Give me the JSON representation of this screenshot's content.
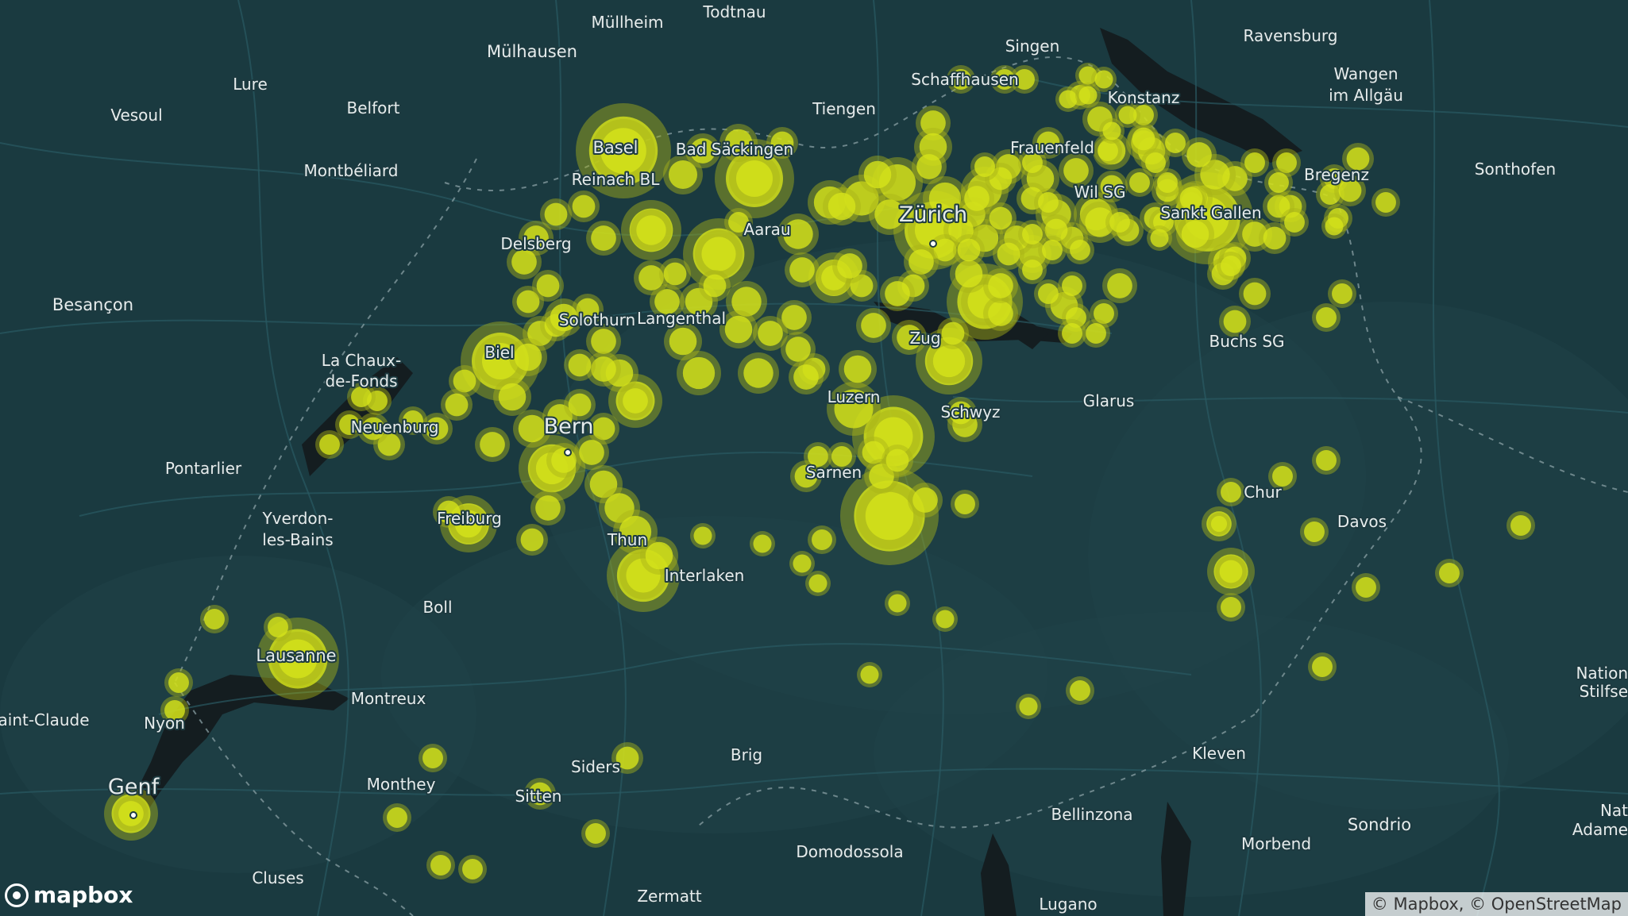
{
  "map": {
    "colors": {
      "background": "#1a3a40",
      "terrain": "#1f4248",
      "water": "#141d20",
      "roads": "#2a5a62",
      "borders": "#8aa0a4",
      "cluster": "#d6e41a",
      "cluster_ring": "#a9b318"
    },
    "places": [
      {
        "name": "Mülhausen",
        "tier": 2
      },
      {
        "name": "Müllheim",
        "tier": 3
      },
      {
        "name": "Todtnau",
        "tier": 3
      },
      {
        "name": "Singen",
        "tier": 3
      },
      {
        "name": "Ravensburg",
        "tier": 3
      },
      {
        "name": "Wangen",
        "tier": 3
      },
      {
        "name": "im Allgäu",
        "tier": 3
      },
      {
        "name": "Lure",
        "tier": 3
      },
      {
        "name": "Vesoul",
        "tier": 3
      },
      {
        "name": "Belfort",
        "tier": 3
      },
      {
        "name": "Montbéliard",
        "tier": 3
      },
      {
        "name": "Tiengen",
        "tier": 3
      },
      {
        "name": "Schaffhausen",
        "tier": 3
      },
      {
        "name": "Konstanz",
        "tier": 3
      },
      {
        "name": "Basel",
        "tier": 2
      },
      {
        "name": "Bad Säckingen",
        "tier": 3
      },
      {
        "name": "Reinach BL",
        "tier": 3
      },
      {
        "name": "Frauenfeld",
        "tier": 3
      },
      {
        "name": "Bregenz",
        "tier": 3
      },
      {
        "name": "Sonthofen",
        "tier": 3
      },
      {
        "name": "Wil SG",
        "tier": 3
      },
      {
        "name": "Zürich",
        "tier": 1
      },
      {
        "name": "Sankt Gallen",
        "tier": 3
      },
      {
        "name": "Aarau",
        "tier": 3
      },
      {
        "name": "Delsberg",
        "tier": 3
      },
      {
        "name": "Besançon",
        "tier": 2
      },
      {
        "name": "Solothurn",
        "tier": 3
      },
      {
        "name": "Langenthal",
        "tier": 3
      },
      {
        "name": "Biel",
        "tier": 3
      },
      {
        "name": "Zug",
        "tier": 3
      },
      {
        "name": "Buchs SG",
        "tier": 3
      },
      {
        "name": "La Chaux-",
        "tier": 3
      },
      {
        "name": "de-Fonds",
        "tier": 3
      },
      {
        "name": "Luzern",
        "tier": 3
      },
      {
        "name": "Glarus",
        "tier": 3
      },
      {
        "name": "Neuenburg",
        "tier": 3
      },
      {
        "name": "Schwyz",
        "tier": 3
      },
      {
        "name": "Bern",
        "tier": 1
      },
      {
        "name": "Pontarlier",
        "tier": 3
      },
      {
        "name": "Sarnen",
        "tier": 3
      },
      {
        "name": "Chur",
        "tier": 3
      },
      {
        "name": "Davos",
        "tier": 3
      },
      {
        "name": "Yverdon-",
        "tier": 3
      },
      {
        "name": "les-Bains",
        "tier": 3
      },
      {
        "name": "Freiburg",
        "tier": 3
      },
      {
        "name": "Thun",
        "tier": 3
      },
      {
        "name": "Interlaken",
        "tier": 3
      },
      {
        "name": "Boll",
        "tier": 3
      },
      {
        "name": "Lausanne",
        "tier": 2
      },
      {
        "name": "Nation",
        "tier": 3
      },
      {
        "name": "Stilfse",
        "tier": 3
      },
      {
        "name": "Montreux",
        "tier": 3
      },
      {
        "name": "aint-Claude",
        "tier": 3
      },
      {
        "name": "Nyon",
        "tier": 3
      },
      {
        "name": "Brig",
        "tier": 3
      },
      {
        "name": "Kleven",
        "tier": 3
      },
      {
        "name": "Siders",
        "tier": 3
      },
      {
        "name": "Monthey",
        "tier": 3
      },
      {
        "name": "Genf",
        "tier": 1
      },
      {
        "name": "Sitten",
        "tier": 3
      },
      {
        "name": "Bellinzona",
        "tier": 3
      },
      {
        "name": "Nat",
        "tier": 3
      },
      {
        "name": "Adame",
        "tier": 3
      },
      {
        "name": "Sondrio",
        "tier": 2
      },
      {
        "name": "Morbend",
        "tier": 3
      },
      {
        "name": "Domodossola",
        "tier": 3
      },
      {
        "name": "Cluses",
        "tier": 3
      },
      {
        "name": "Zermatt",
        "tier": 3
      },
      {
        "name": "Lugano",
        "tier": 3
      }
    ]
  },
  "branding": {
    "logo_text": "mapbox",
    "logo_icon": "mapbox-logo-icon"
  },
  "attribution": "© Mapbox, © OpenStreetMap"
}
